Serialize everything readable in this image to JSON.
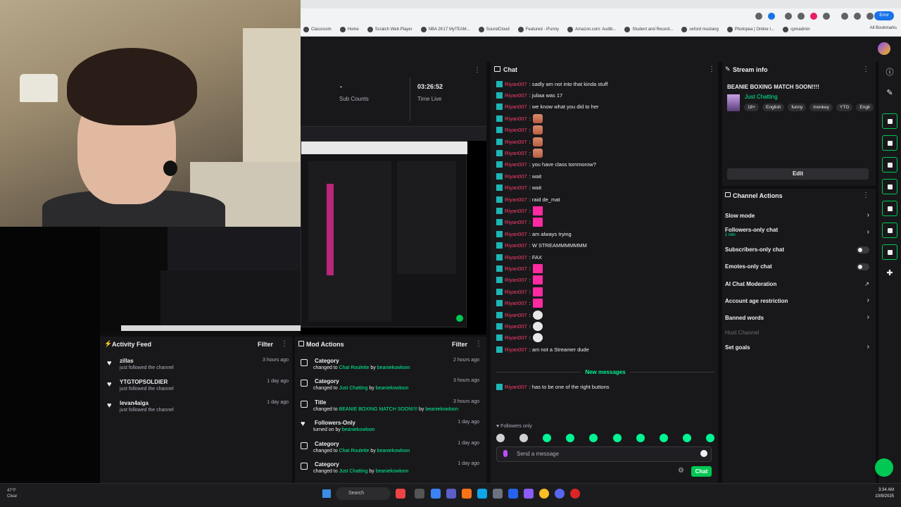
{
  "browser": {
    "bookmarks": [
      "Classroom",
      "Home",
      "Scratch Web Player",
      "NBA 2K17 MyTEAM...",
      "SoundCloud",
      "Featured - iFunny",
      "Amazon.com: Audib...",
      "Student and Recent...",
      "oxford mustang",
      "Photopea | Online I...",
      "cpmadmin"
    ],
    "all_bookmarks": "All Bookmarks",
    "error_badge": "Error"
  },
  "stats": {
    "sub_counts_value": "-",
    "sub_counts_label": "Sub Counts",
    "time_live_value": "03:26:52",
    "time_live_label": "Time Live"
  },
  "activity_feed": {
    "title": "Activity Feed",
    "filter": "Filter",
    "items": [
      {
        "name": "zillas",
        "sub": "just followed the channel",
        "time": "3 hours ago"
      },
      {
        "name": "YTGTOPSOLDIER",
        "sub": "just followed the channel",
        "time": "1 day ago"
      },
      {
        "name": "levan4aiga",
        "sub": "just followed the channel",
        "time": "1 day ago"
      }
    ]
  },
  "mod_actions": {
    "title": "Mod Actions",
    "filter": "Filter",
    "items": [
      {
        "title": "Category",
        "pre": "changed to ",
        "target": "Chat Roulette",
        "by": " by ",
        "user": "beaniekowloon",
        "time": "2 hours ago"
      },
      {
        "title": "Category",
        "pre": "changed to ",
        "target": "Just Chatting",
        "by": " by ",
        "user": "beaniekowloon",
        "time": "3 hours ago"
      },
      {
        "title": "Title",
        "pre": "changed to ",
        "target": "BEANIE BOXING MATCH SOON!!!!",
        "by": " by ",
        "user": "beaniekowloon",
        "time": "3 hours ago"
      },
      {
        "title": "Followers-Only",
        "pre": "turned on by ",
        "target": "",
        "by": "",
        "user": "beaniekowloon",
        "time": "1 day ago"
      },
      {
        "title": "Category",
        "pre": "changed to ",
        "target": "Chat Roulette",
        "by": " by ",
        "user": "beaniekowloon",
        "time": "1 day ago"
      },
      {
        "title": "Category",
        "pre": "changed to ",
        "target": "Just Chatting",
        "by": " by ",
        "user": "beaniekowloon",
        "time": "1 day ago"
      }
    ]
  },
  "chat": {
    "title": "Chat",
    "username": "Riyan007",
    "messages": [
      {
        "text": ": sadly am not into that kinda stuff",
        "emote": ""
      },
      {
        "text": ": juliaa was 17",
        "emote": ""
      },
      {
        "text": ": we know what you did to her",
        "emote": ""
      },
      {
        "text": ": ",
        "emote": "peach"
      },
      {
        "text": ": ",
        "emote": "peach"
      },
      {
        "text": ": ",
        "emote": "peach"
      },
      {
        "text": ": ",
        "emote": "peach"
      },
      {
        "text": ": you have class tommorow?",
        "emote": ""
      },
      {
        "text": ": wait",
        "emote": ""
      },
      {
        "text": ": wait",
        "emote": ""
      },
      {
        "text": ": raid de_mat",
        "emote": ""
      },
      {
        "text": ": ",
        "emote": "pink"
      },
      {
        "text": ": ",
        "emote": "pink"
      },
      {
        "text": ": am always trying",
        "emote": ""
      },
      {
        "text": ": W STREAMMMMMMM",
        "emote": ""
      },
      {
        "text": ": FAX",
        "emote": ""
      },
      {
        "text": ": ",
        "emote": "pink"
      },
      {
        "text": ": ",
        "emote": "pink"
      },
      {
        "text": ": ",
        "emote": "pink"
      },
      {
        "text": ": ",
        "emote": "pink"
      },
      {
        "text": ": ",
        "emote": "skull"
      },
      {
        "text": ": ",
        "emote": "skull"
      },
      {
        "text": ": ",
        "emote": "skull"
      },
      {
        "text": ": am not a Streamer dude",
        "emote": ""
      }
    ],
    "new_messages": "New messages",
    "after_new": {
      "text": ": has to be one of the right buttons"
    },
    "followers_only": "Followers only",
    "input_placeholder": "Send a message",
    "send_label": "Chat"
  },
  "stream_info": {
    "title": "Stream info",
    "stream_title": "BEANIE BOXING MATCH SOON!!!!",
    "category": "Just Chatting",
    "tags": [
      "18+",
      "English",
      "funny",
      "monkey",
      "YTG",
      "Engli"
    ],
    "edit": "Edit"
  },
  "channel_actions": {
    "title": "Channel Actions",
    "slow_mode": "Slow mode",
    "followers_only_chat": "Followers-only chat",
    "followers_only_sub": "1 min",
    "subscribers_only": "Subscribers-only chat",
    "emotes_only": "Emotes-only chat",
    "ai_moderation": "AI Chat Moderation",
    "account_age": "Account age restriction",
    "banned_words": "Banned words",
    "host_channel": "Host Channel",
    "set_goals": "Set goals"
  },
  "taskbar": {
    "weather_temp": "47°F",
    "weather_desc": "Clear",
    "search": "Search",
    "time": "3:34 AM",
    "date": "10/9/2025"
  },
  "colors": {
    "accent": "#00f593",
    "brand_green": "#00c853",
    "username": "#ff3d6b",
    "panel": "#18181b"
  }
}
